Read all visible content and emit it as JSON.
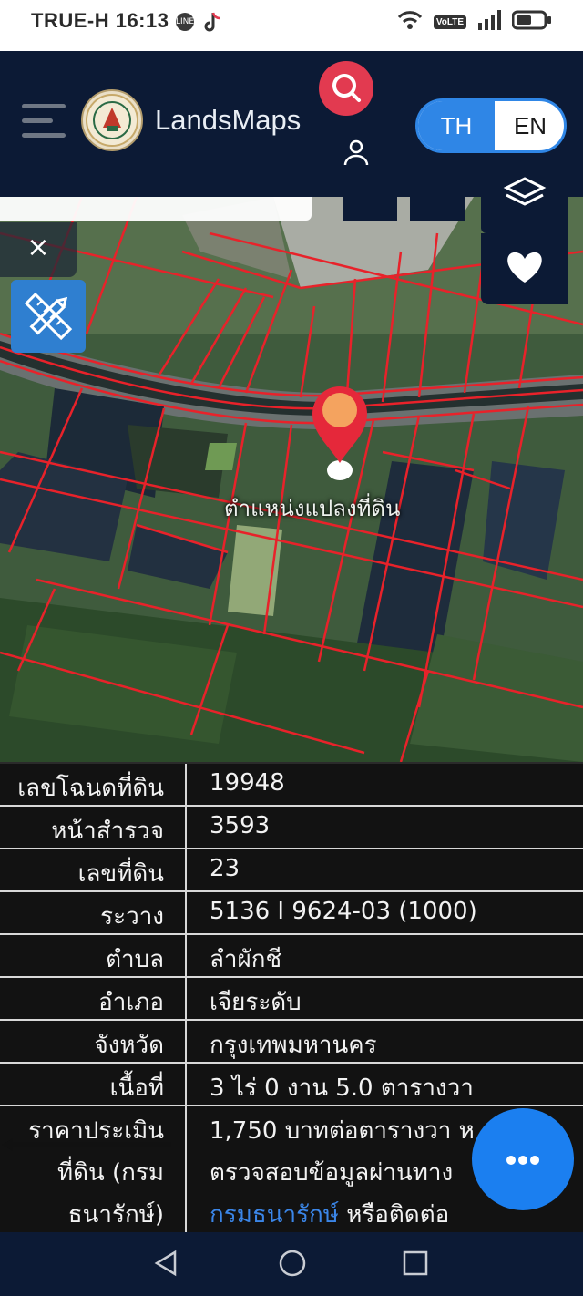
{
  "status_bar": {
    "carrier_time": "TRUE-H 16:13",
    "line_chip": "LINE",
    "volte": "VoLTE"
  },
  "header": {
    "brand": "LandsMaps",
    "lang_th": "TH",
    "lang_en": "EN"
  },
  "map": {
    "marker_label": "ตำแหน่งแปลงที่ดิน",
    "close_symbol": "×"
  },
  "parcel_info": {
    "rows": [
      {
        "label": "เลขโฉนดที่ดิน",
        "value": "19948"
      },
      {
        "label": "หน้าสำรวจ",
        "value": "3593"
      },
      {
        "label": "เลขที่ดิน",
        "value": "23"
      },
      {
        "label": "ระวาง",
        "value": "5136 I 9624-03 (1000)"
      },
      {
        "label": "ตำบล",
        "value": "ลำผักชี"
      },
      {
        "label": "อำเภอ",
        "value": "เจียระดับ"
      },
      {
        "label": "จังหวัด",
        "value": "กรุงเทพมหานคร"
      },
      {
        "label": "เนื้อที่",
        "value": "3 ไร่ 0 งาน 5.0 ตารางวา"
      }
    ],
    "price": {
      "label_1": "ราคาประเมิน",
      "label_2": "ที่ดิน (กรม",
      "label_3": "ธนารักษ์)",
      "value_1": "1,750 บาทต่อตารางวา ห",
      "value_2": "ตรวจสอบข้อมูลผ่านทาง",
      "value_link": "กรมธนารักษ์",
      "value_3_rest": " หรือติดต่อ"
    }
  },
  "colors": {
    "header_bg": "#0c1a35",
    "accent_red": "#e23a50",
    "accent_blue": "#2f86e6",
    "parcel_line": "#e8222a"
  }
}
